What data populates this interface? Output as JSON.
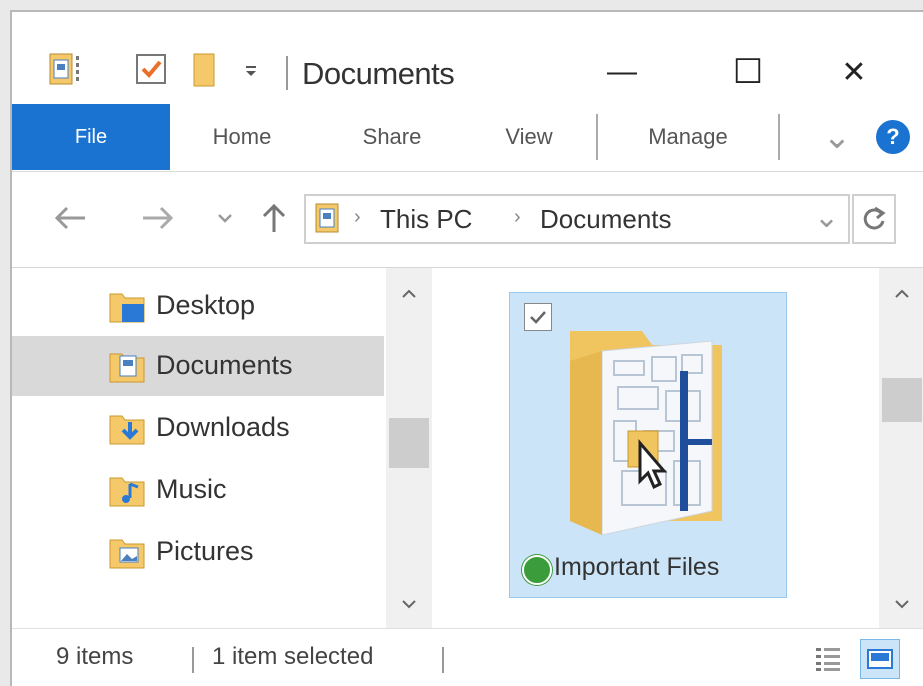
{
  "window": {
    "title": "Documents",
    "controls": {
      "minimize": "—",
      "maximize": "☐",
      "close": "✕"
    }
  },
  "ribbon": {
    "tabs": [
      {
        "label": "File"
      },
      {
        "label": "Home"
      },
      {
        "label": "Share"
      },
      {
        "label": "View"
      },
      {
        "label": "Manage"
      }
    ],
    "expand_glyph": "⌄",
    "help_glyph": "?"
  },
  "address_bar": {
    "crumbs": [
      "This PC",
      "Documents"
    ],
    "separator": "›",
    "dropdown_glyph": "⌄"
  },
  "nav_pane": {
    "items": [
      {
        "label": "Desktop",
        "icon": "desktop-folder-icon",
        "selected": false
      },
      {
        "label": "Documents",
        "icon": "documents-folder-icon",
        "selected": true
      },
      {
        "label": "Downloads",
        "icon": "downloads-folder-icon",
        "selected": false
      },
      {
        "label": "Music",
        "icon": "music-folder-icon",
        "selected": false
      },
      {
        "label": "Pictures",
        "icon": "pictures-folder-icon",
        "selected": false
      }
    ]
  },
  "content": {
    "items": [
      {
        "label": "Important Files",
        "icon": "folder-icon",
        "selected": true,
        "checked": true
      }
    ]
  },
  "status_bar": {
    "item_count": "9 items",
    "selection": "1 item selected"
  },
  "colors": {
    "accent": "#1a73d0",
    "selection_bg": "#cce4f7",
    "nav_selected_bg": "#d9d9d9",
    "folder": "#f5c96a"
  }
}
